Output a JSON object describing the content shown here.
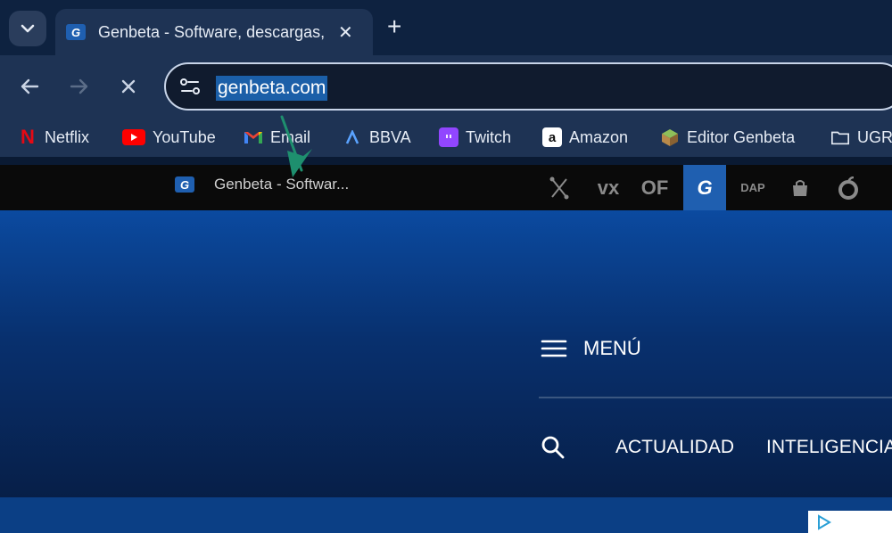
{
  "tab": {
    "favicon_letter": "G",
    "title": "Genbeta - Software, descargas, juegos"
  },
  "toolbar": {
    "url": "genbeta.com"
  },
  "bookmarks": [
    {
      "label": "Netflix",
      "icon": "netflix-icon"
    },
    {
      "label": "YouTube",
      "icon": "youtube-icon"
    },
    {
      "label": "Email",
      "icon": "gmail-icon"
    },
    {
      "label": "BBVA",
      "icon": "bbva-icon"
    },
    {
      "label": "Twitch",
      "icon": "twitch-icon"
    },
    {
      "label": "Amazon",
      "icon": "amazon-icon"
    },
    {
      "label": "Editor Genbeta",
      "icon": "package-icon"
    },
    {
      "label": "UGR",
      "icon": "folder-icon"
    }
  ],
  "site_bar": {
    "tooltip": "Genbeta - Softwar...",
    "network_icons": [
      "xataka-icon",
      "vx",
      "OF",
      "G",
      "DAP",
      "bag-icon",
      "apple-icon"
    ]
  },
  "page": {
    "menu_label": "MENÚ",
    "nav": [
      "ACTUALIDAD",
      "INTELIGENCIA"
    ]
  },
  "colors": {
    "accent": "#1f5fb0",
    "chrome_bg": "#1e3354",
    "hero_top": "#0b4aa0"
  }
}
